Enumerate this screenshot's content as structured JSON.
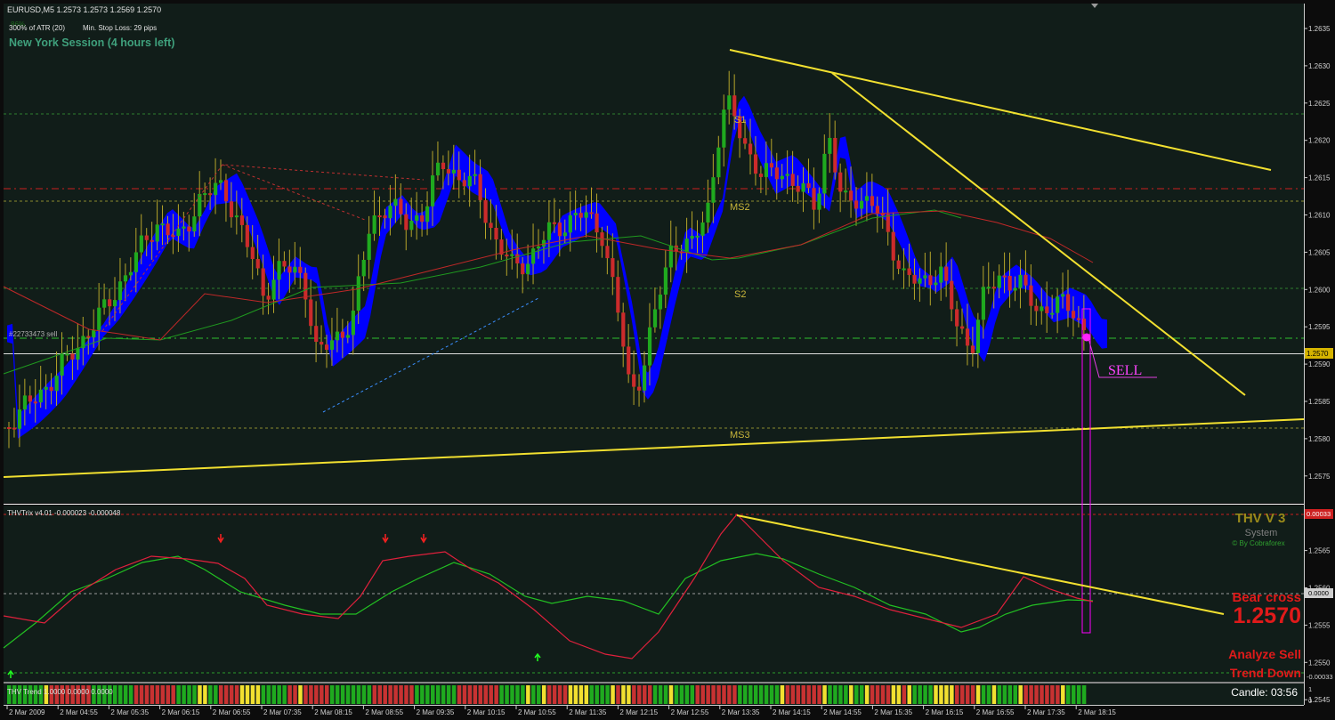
{
  "header": {
    "symbol_line": "EURUSD,M5  1.2573 1.2573 1.2569 1.2570",
    "atr_label": "300% of ATR (20)",
    "stoploss_label": "Min. Stop Loss:  29 pips",
    "session": "New York Session (4 hours left)",
    "tiny_label": "86%"
  },
  "price_axis": {
    "labels": [
      "1.2635",
      "1.2630",
      "1.2625",
      "1.2620",
      "1.2615",
      "1.2610",
      "1.2605",
      "1.2600",
      "1.2595",
      "1.2590",
      "1.2585",
      "1.2580",
      "1.2575",
      "1.2570",
      "1.2565",
      "1.2560",
      "1.2555",
      "1.2550",
      "1.2545"
    ],
    "current": "1.2570"
  },
  "levels": {
    "s1": "S1",
    "ms2": "MS2",
    "s2": "S2",
    "ms3": "MS3",
    "order": "#22733473 sell"
  },
  "signal": {
    "label": "SELL"
  },
  "indicator": {
    "title": "THVTrix v4.01 -0.000023 -0.000048",
    "axis_top": "0.00033",
    "axis_zero": "0.0000",
    "axis_bottom": "-0.00033"
  },
  "brand": {
    "title": "THV V 3",
    "subtitle": "System",
    "credit": "© By Cobraforex"
  },
  "analysis": {
    "cross": "Bear cross",
    "price": "1.2570",
    "analyze": "Analyze Sell",
    "trend": "Trend Down",
    "candle": "Candle:  03:56"
  },
  "trend_bar": {
    "title": "THV Trend 1.0000 0.0000 0.0000",
    "axis_top": "1",
    "axis_bottom": "0"
  },
  "time_axis": [
    "2 Mar 2009",
    "2 Mar 04:55",
    "2 Mar 05:35",
    "2 Mar 06:15",
    "2 Mar 06:55",
    "2 Mar 07:35",
    "2 Mar 08:15",
    "2 Mar 08:55",
    "2 Mar 09:35",
    "2 Mar 10:15",
    "2 Mar 10:55",
    "2 Mar 11:35",
    "2 Mar 12:15",
    "2 Mar 12:55",
    "2 Mar 13:35",
    "2 Mar 14:15",
    "2 Mar 14:55",
    "2 Mar 15:35",
    "2 Mar 16:15",
    "2 Mar 16:55",
    "2 Mar 17:35",
    "2 Mar 18:15"
  ],
  "colors": {
    "background": "#111d19",
    "bull": "#1faa1f",
    "bear": "#cc2b2b",
    "cloud": "#0000ff",
    "trendline": "#f2e030",
    "signal": "#ff00ff",
    "brand": "#9a8a1a"
  }
}
